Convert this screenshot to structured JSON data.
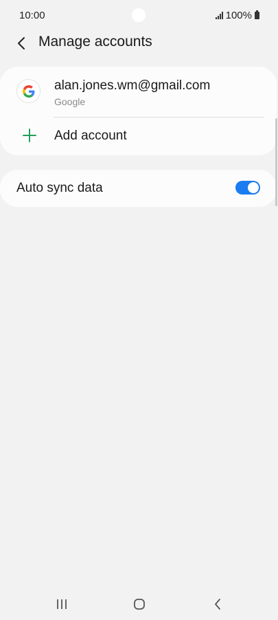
{
  "status_bar": {
    "time": "10:00",
    "battery": "100%"
  },
  "header": {
    "title": "Manage accounts",
    "back_icon": "chevron-left-icon"
  },
  "accounts": [
    {
      "email": "alan.jones.wm@gmail.com",
      "type": "Google",
      "icon": "google-logo-icon"
    }
  ],
  "add_account": {
    "label": "Add account",
    "icon": "plus-icon",
    "icon_color": "#1fa05a"
  },
  "auto_sync": {
    "label": "Auto sync data",
    "enabled": true,
    "accent": "#1a7cf0"
  },
  "nav_bar": {
    "recents_icon": "recents-icon",
    "home_icon": "home-icon",
    "back_icon": "back-icon"
  }
}
